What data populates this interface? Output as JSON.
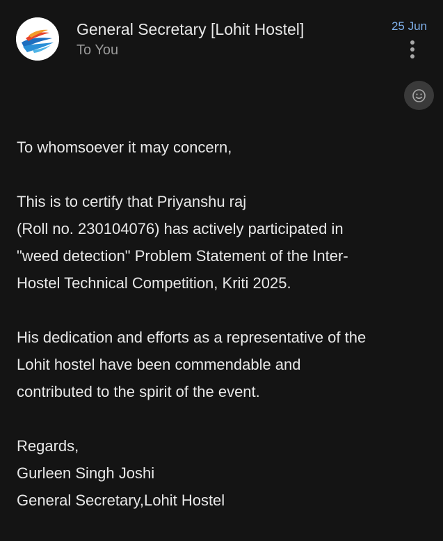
{
  "email": {
    "sender": "General Secretary [Lohit Hostel]",
    "recipient": "To You",
    "date": "25 Jun",
    "avatar_icon": "hostel-logo-icon",
    "menu_icon": "more-vert-icon",
    "react_icon": "smiley-icon",
    "accent_color": "#7fb0ea"
  },
  "body": {
    "greeting": "To whomsoever it may concern,",
    "para1": [
      "This is to certify that Priyanshu raj",
      "(Roll no. 230104076) has actively participated in",
      "\"weed detection\" Problem Statement of the Inter-",
      "Hostel Technical Competition, Kriti 2025."
    ],
    "para2": [
      "His dedication and efforts as a representative of the",
      "Lohit hostel have been commendable and",
      "contributed to the spirit of the event."
    ],
    "signoff": [
      "Regards,",
      "Gurleen Singh Joshi",
      "General Secretary,Lohit Hostel"
    ]
  }
}
